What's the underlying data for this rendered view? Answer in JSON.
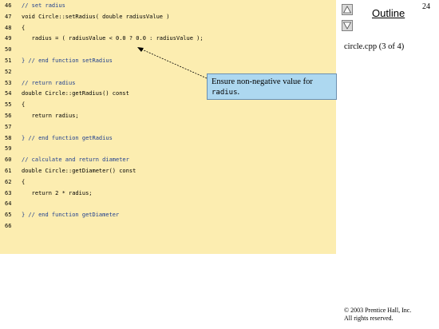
{
  "page_number": "24",
  "outline": {
    "title": "Outline",
    "file_label": "circle.cpp (3 of 4)",
    "prev_icon": "triangle-up-icon",
    "next_icon": "triangle-down-icon"
  },
  "code_lines": [
    {
      "n": "46",
      "text": "// set radius"
    },
    {
      "n": "47",
      "text": "void Circle::setRadius( double radiusValue )"
    },
    {
      "n": "48",
      "text": "{"
    },
    {
      "n": "49",
      "text": "   radius = ( radiusValue < 0.0 ? 0.0 : radiusValue );"
    },
    {
      "n": "50",
      "text": ""
    },
    {
      "n": "51",
      "text": "} // end function setRadius"
    },
    {
      "n": "52",
      "text": ""
    },
    {
      "n": "53",
      "text": "// return radius"
    },
    {
      "n": "54",
      "text": "double Circle::getRadius() const"
    },
    {
      "n": "55",
      "text": "{"
    },
    {
      "n": "56",
      "text": "   return radius;"
    },
    {
      "n": "57",
      "text": ""
    },
    {
      "n": "58",
      "text": "} // end function getRadius"
    },
    {
      "n": "59",
      "text": ""
    },
    {
      "n": "60",
      "text": "// calculate and return diameter"
    },
    {
      "n": "61",
      "text": "double Circle::getDiameter() const"
    },
    {
      "n": "62",
      "text": "{"
    },
    {
      "n": "63",
      "text": "   return 2 * radius;"
    },
    {
      "n": "64",
      "text": ""
    },
    {
      "n": "65",
      "text": "} // end function getDiameter"
    },
    {
      "n": "66",
      "text": ""
    }
  ],
  "callout": {
    "text_before": "Ensure non-negative value for ",
    "code": "radius",
    "text_after": "."
  },
  "copyright": {
    "line1": "© 2003 Prentice Hall, Inc.",
    "line2": "All rights reserved."
  },
  "colors": {
    "code_background": "#fcedb0",
    "callout_background": "#add8f0"
  }
}
